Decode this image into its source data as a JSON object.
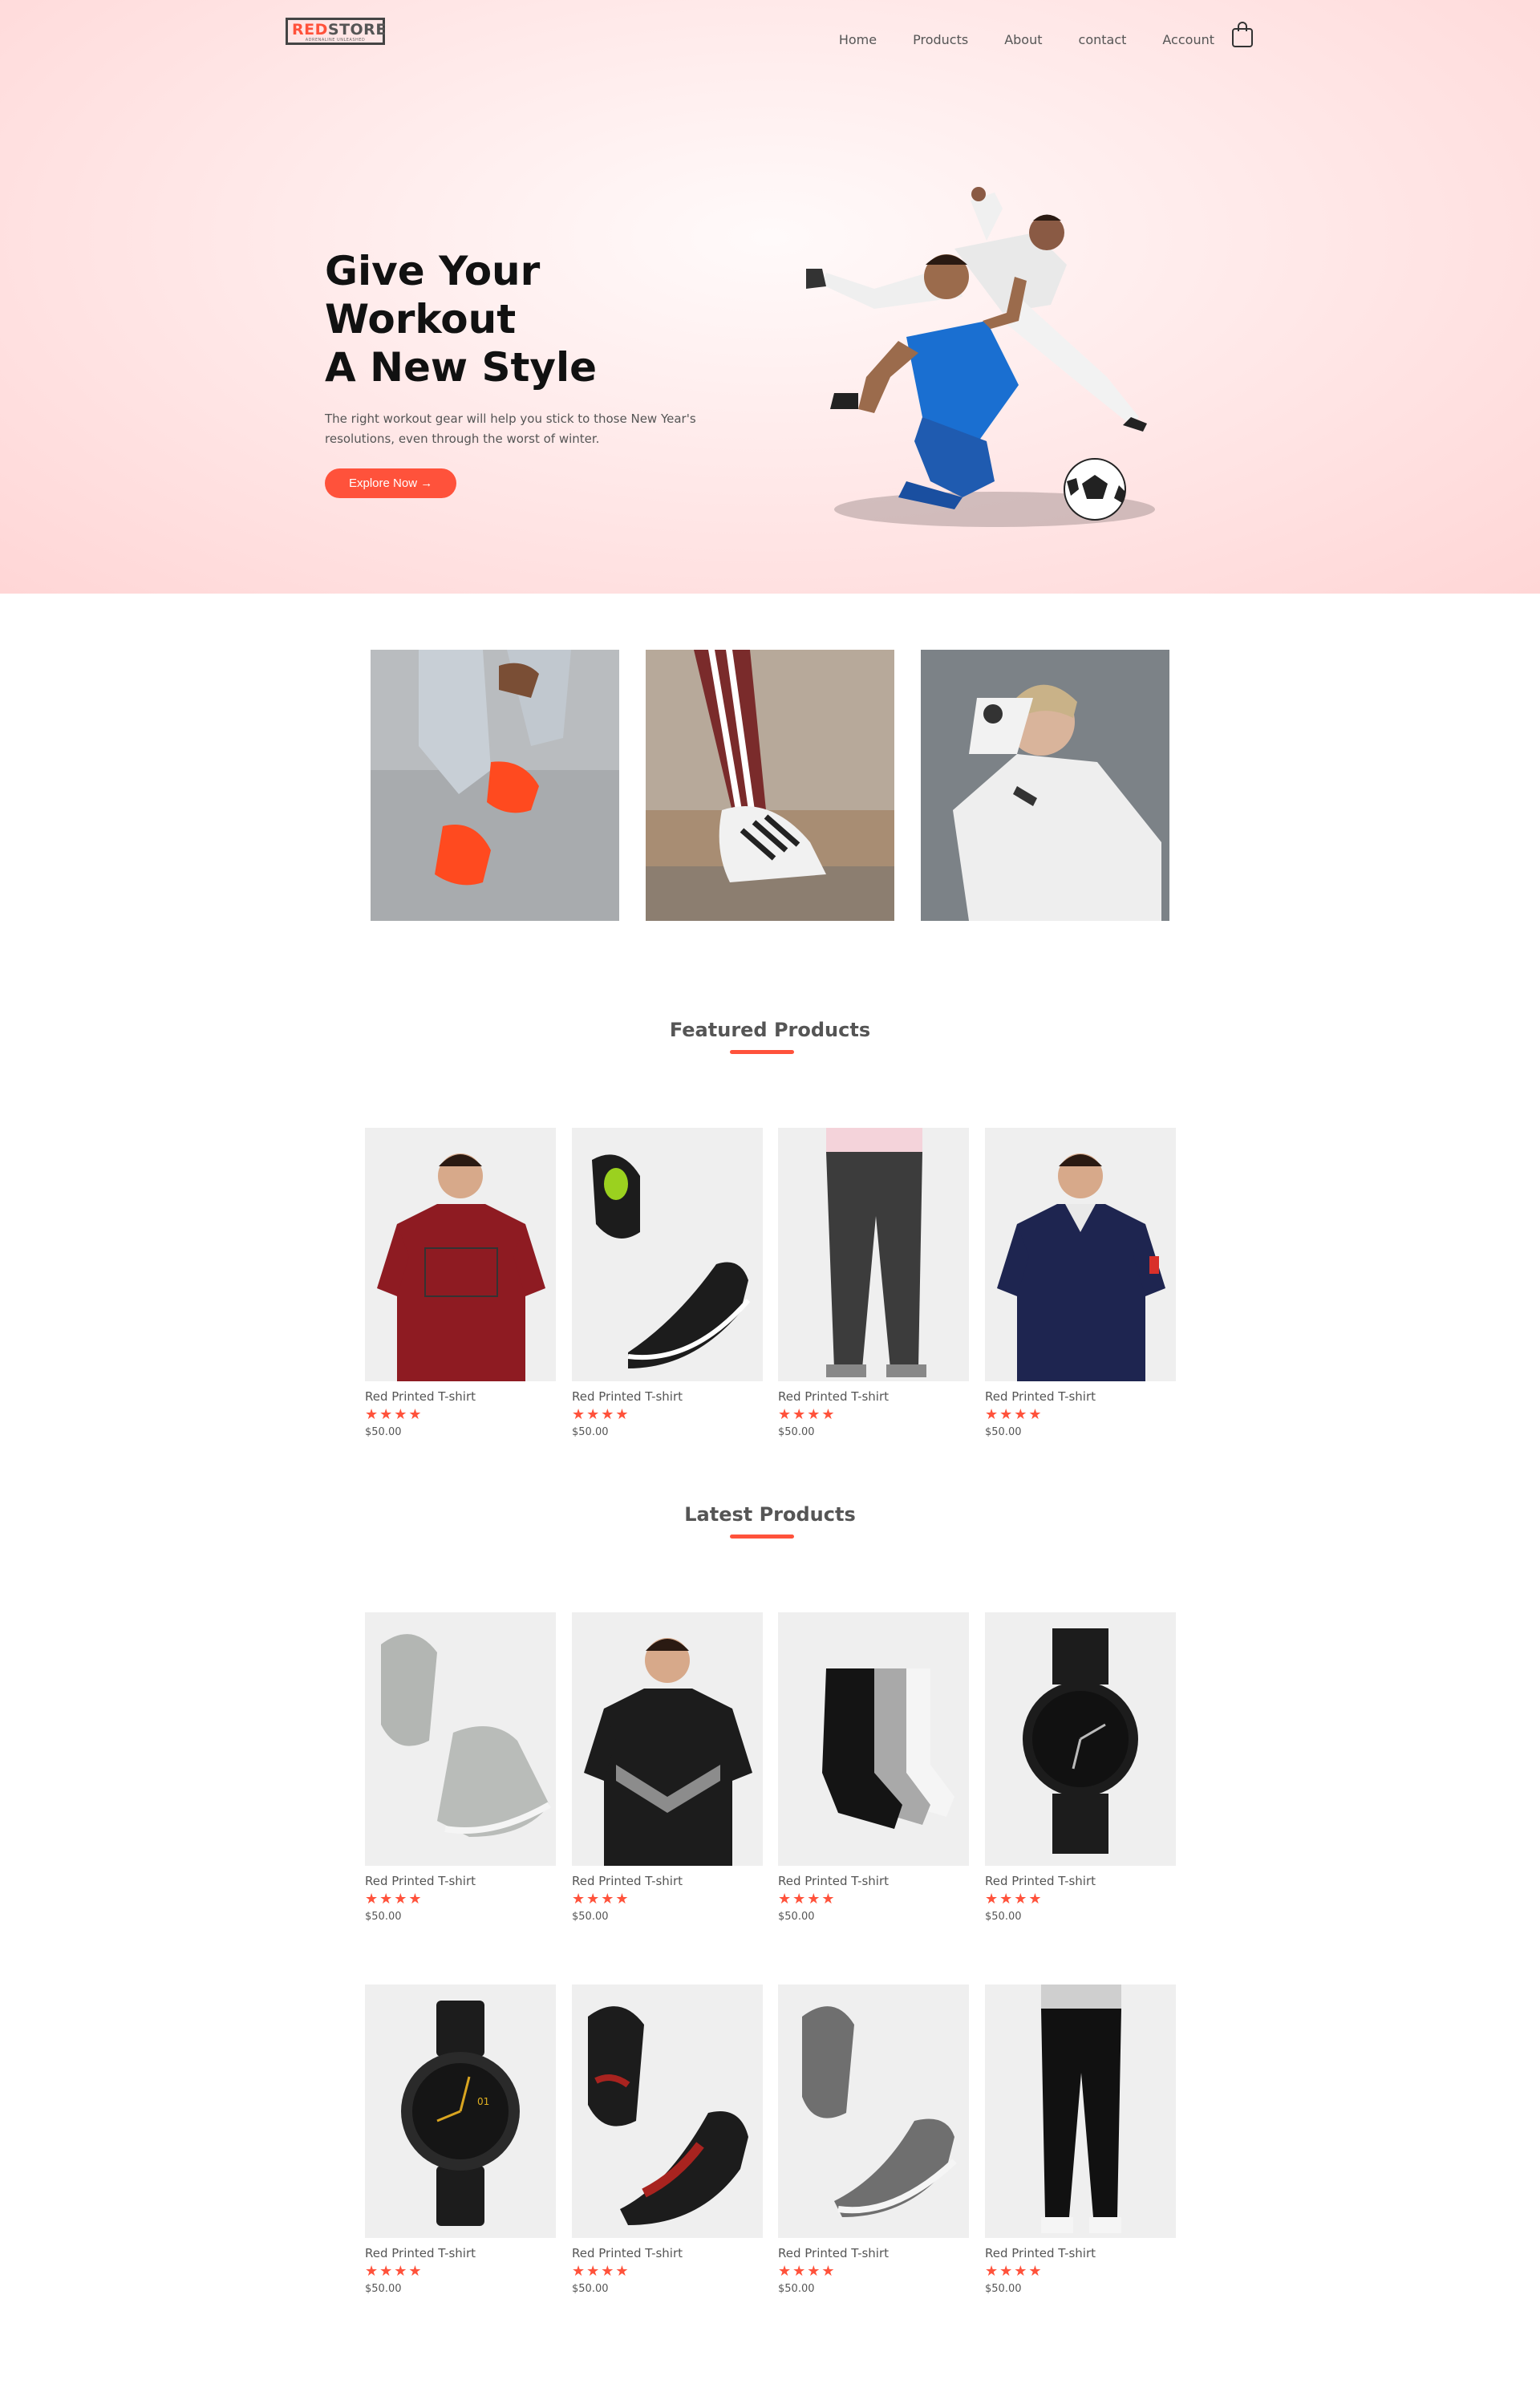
{
  "header": {
    "logo": {
      "red": "RED",
      "dark": "STORE",
      "tagline": "ADRENALINE UNLEASHED"
    },
    "nav": [
      "Home",
      "Products",
      "About",
      "contact",
      "Account"
    ],
    "cart_icon": "shopping-bag-icon"
  },
  "hero": {
    "title_line1": "Give Your Workout",
    "title_line2": "A New Style",
    "description": "The right workout gear will help you stick to those New Year's resolutions, even through the worst of winter.",
    "button_label": "Explore Now →"
  },
  "categories": [
    "red sneakers on concrete",
    "striped sneaker on stone ledge",
    "woman in white hoodie with watch"
  ],
  "featured": {
    "title": "Featured Products",
    "items": [
      {
        "name": "Red Printed T-shirt",
        "stars": "★★★★",
        "price": "$50.00",
        "image": "red-tshirt"
      },
      {
        "name": "Red Printed T-shirt",
        "stars": "★★★★",
        "price": "$50.00",
        "image": "black-shoes"
      },
      {
        "name": "Red Printed T-shirt",
        "stars": "★★★★",
        "price": "$50.00",
        "image": "grey-trousers"
      },
      {
        "name": "Red Printed T-shirt",
        "stars": "★★★★",
        "price": "$50.00",
        "image": "navy-polo"
      }
    ]
  },
  "latest": {
    "title": "Latest Products",
    "row1": [
      {
        "name": "Red Printed T-shirt",
        "stars": "★★★★",
        "price": "$50.00",
        "image": "grey-hightops"
      },
      {
        "name": "Red Printed T-shirt",
        "stars": "★★★★",
        "price": "$50.00",
        "image": "black-puma-tshirt"
      },
      {
        "name": "Red Printed T-shirt",
        "stars": "★★★★",
        "price": "$50.00",
        "image": "socks"
      },
      {
        "name": "Red Printed T-shirt",
        "stars": "★★★★",
        "price": "$50.00",
        "image": "black-watch"
      }
    ],
    "row2": [
      {
        "name": "Red Printed T-shirt",
        "stars": "★★★★",
        "price": "$50.00",
        "image": "leather-watch"
      },
      {
        "name": "Red Printed T-shirt",
        "stars": "★★★★",
        "price": "$50.00",
        "image": "black-red-shoes"
      },
      {
        "name": "Red Printed T-shirt",
        "stars": "★★★★",
        "price": "$50.00",
        "image": "grey-slipons"
      },
      {
        "name": "Red Printed T-shirt",
        "stars": "★★★★",
        "price": "$50.00",
        "image": "black-joggers"
      }
    ]
  },
  "colors": {
    "accent": "#ff523b",
    "hero_bg": "#ffd6d6",
    "card_bg": "#f2f2f2"
  }
}
